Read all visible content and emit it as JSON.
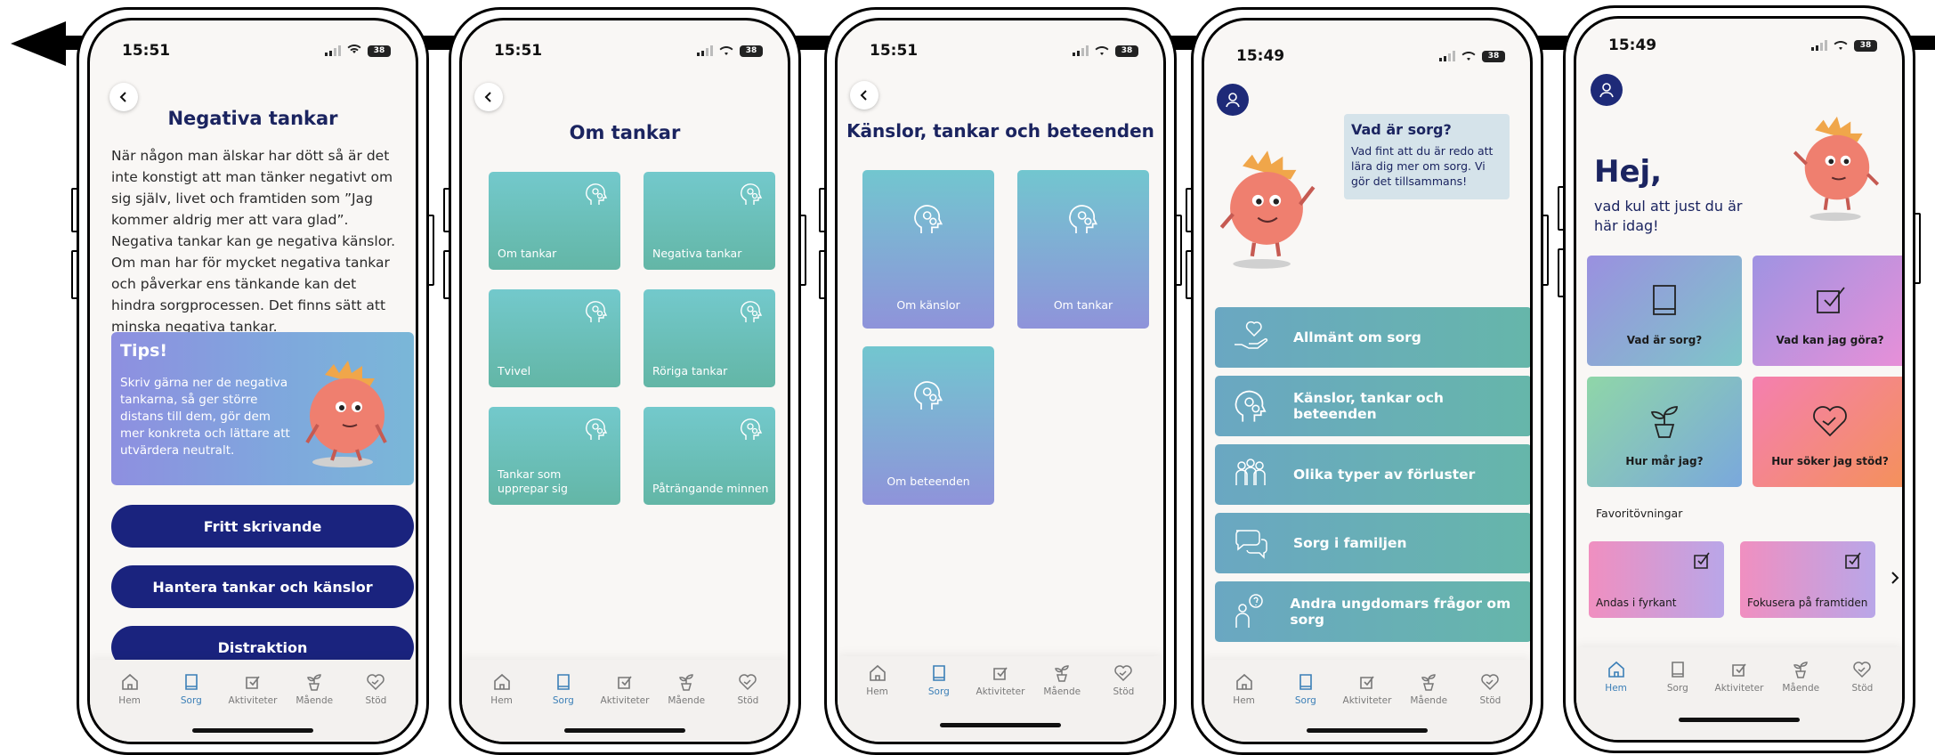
{
  "status_times": [
    "15:51",
    "15:51",
    "15:51",
    "15:49",
    "15:49"
  ],
  "battery": "38",
  "tabbar": [
    {
      "label": "Hem",
      "icon": "house-icon"
    },
    {
      "label": "Sorg",
      "icon": "book-icon"
    },
    {
      "label": "Aktiviteter",
      "icon": "checkbox-icon"
    },
    {
      "label": "Mående",
      "icon": "plant-icon"
    },
    {
      "label": "Stöd",
      "icon": "heart-handshake-icon"
    }
  ],
  "screen1": {
    "title": "Negativa tankar",
    "body": "När någon man älskar har dött så är det inte konstigt att man tänker negativt om sig själv, livet och framtiden som ”Jag kommer aldrig mer att vara glad”. Negativa tankar kan ge negativa känslor. Om man har för mycket negativa tankar och påverkar ens tänkande kan det hindra sorgprocessen. Det finns sätt att minska negativa tankar.",
    "tips_title": "Tips!",
    "tips_text": "Skriv gärna ner de negativa tankarna, så ger större distans till dem, gör dem mer konkreta och lättare att utvärdera neutralt.",
    "buttons": [
      "Fritt skrivande",
      "Hantera tankar och känslor",
      "Distraktion"
    ]
  },
  "screen2": {
    "title": "Om tankar",
    "cards": [
      "Om tankar",
      "Negativa tankar",
      "Tvivel",
      "Röriga tankar",
      "Tankar som upprepar sig",
      "Påträngande minnen"
    ]
  },
  "screen3": {
    "title": "Känslor, tankar och beteenden",
    "cards": [
      "Om känslor",
      "Om tankar",
      "Om beteenden"
    ]
  },
  "screen4": {
    "bubble_title": "Vad är sorg?",
    "bubble_text": "Vad fint att du är redo att lära dig mer om sorg. Vi gör det tillsammans!",
    "items": [
      {
        "label": "Allmänt om sorg",
        "icon": "heart-hand-icon"
      },
      {
        "label": "Känslor, tankar och beteenden",
        "icon": "head-gears-icon"
      },
      {
        "label": "Olika typer av förluster",
        "icon": "people-group-icon"
      },
      {
        "label": "Sorg i familjen",
        "icon": "chat-bubbles-icon"
      },
      {
        "label": "Andra ungdomars frågor om sorg",
        "icon": "person-question-icon"
      }
    ]
  },
  "screen5": {
    "greeting": "Hej,",
    "subtitle": "vad kul att just du är här idag!",
    "cards": [
      {
        "label": "Vad är sorg?",
        "icon": "book-icon"
      },
      {
        "label": "Vad kan jag göra?",
        "icon": "checkbox-icon"
      },
      {
        "label": "Hur mår jag?",
        "icon": "plant-icon"
      },
      {
        "label": "Hur söker jag stöd?",
        "icon": "heart-handshake-icon"
      }
    ],
    "favorites_label": "Favoritövningar",
    "favorites": [
      "Andas i fyrkant",
      "Fokusera på framtiden"
    ]
  },
  "colors": {
    "navy": "#1a237e",
    "teal": "#66b6aa",
    "active_tab": "#3b7fb7"
  }
}
